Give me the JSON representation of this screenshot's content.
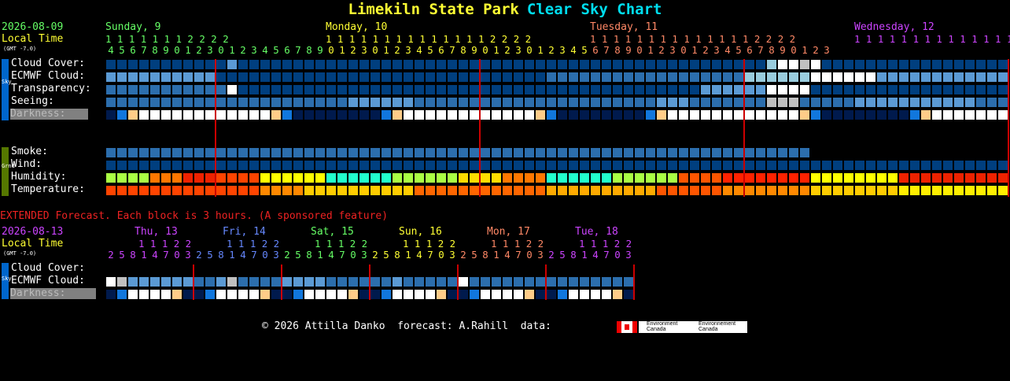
{
  "title": {
    "name": "Limekiln State Park",
    "chart": "Clear Sky Chart"
  },
  "main": {
    "date": "2026-08-09",
    "local_time": "Local Time",
    "gmt": "(GMT -7.0)",
    "days": [
      {
        "label": "Sunday, 9",
        "color": "#66ff66"
      },
      {
        "label": "Monday, 10",
        "color": "#ffff33"
      },
      {
        "label": "Tuesday, 11",
        "color": "#ff8866"
      },
      {
        "label": "Wednesday, 12",
        "color": "#cc44ff"
      }
    ],
    "hour_tens": [
      "1 1 1 1 1 1 1 2 2 2 2",
      "1 1 1 1 1 1 1 1 1 1 1 1 1 1 2 2 2 2",
      "1 1 1 1 1 1 1 1 1 1 1 1 1 1 2 2 2 2",
      "1 1 1 1 1 1 1 1 1 1 1 1 1 1 2 2 2 2"
    ],
    "hour_ones": [
      "456789012301234567890123012345678901230123456789012301234567890123"
    ],
    "hours_line_colors": [
      "#66ff66",
      "#ffff33",
      "#ff8866",
      "#cc44ff"
    ],
    "sky_labels": [
      "Cloud Cover:",
      "ECMWF Cloud:",
      "Transparency:",
      "Seeing:",
      "Darkness:"
    ],
    "ground_labels": [
      "Smoke:",
      "Wind:",
      "Humidity:",
      "Temperature:"
    ],
    "sidebar_sky": "- - - Sky - - -",
    "sidebar_ground": "- Ground -"
  },
  "extended": {
    "heading": "EXTENDED Forecast. Each block is 3 hours. (A sponsored feature)",
    "date": "2026-08-13",
    "local_time": "Local Time",
    "gmt": "(GMT -7.0)",
    "days": [
      {
        "label": "Thu, 13",
        "color": "#cc44ff"
      },
      {
        "label": "Fri, 14",
        "color": "#6688ff"
      },
      {
        "label": "Sat, 15",
        "color": "#66ff66"
      },
      {
        "label": "Sun, 16",
        "color": "#ffff33"
      },
      {
        "label": "Mon, 17",
        "color": "#ff8866"
      },
      {
        "label": "Tue, 18",
        "color": "#cc44ff"
      }
    ],
    "hour_tens": "1 1 1 2 2",
    "hour_ones": "25814703",
    "sky_labels": [
      "Cloud Cover:",
      "ECMWF Cloud:",
      "Darkness:"
    ],
    "sidebar_sky": "- Sky -"
  },
  "footer": {
    "text": "© 2026 Attilla Danko  forecast: A.Rahill  data:",
    "env1": "Environment Canada",
    "env2": "Environnement Canada"
  },
  "colors": {
    "dark_blue": "#003f7f",
    "mid_blue": "#2c6ead",
    "light_blue": "#5b9ad4",
    "pale_blue": "#99ccdd",
    "white": "#ffffff",
    "grey": "#c0c0c0",
    "red_line": "#cc0000",
    "green_side": "#557700",
    "blue_side": "#0066cc"
  }
}
